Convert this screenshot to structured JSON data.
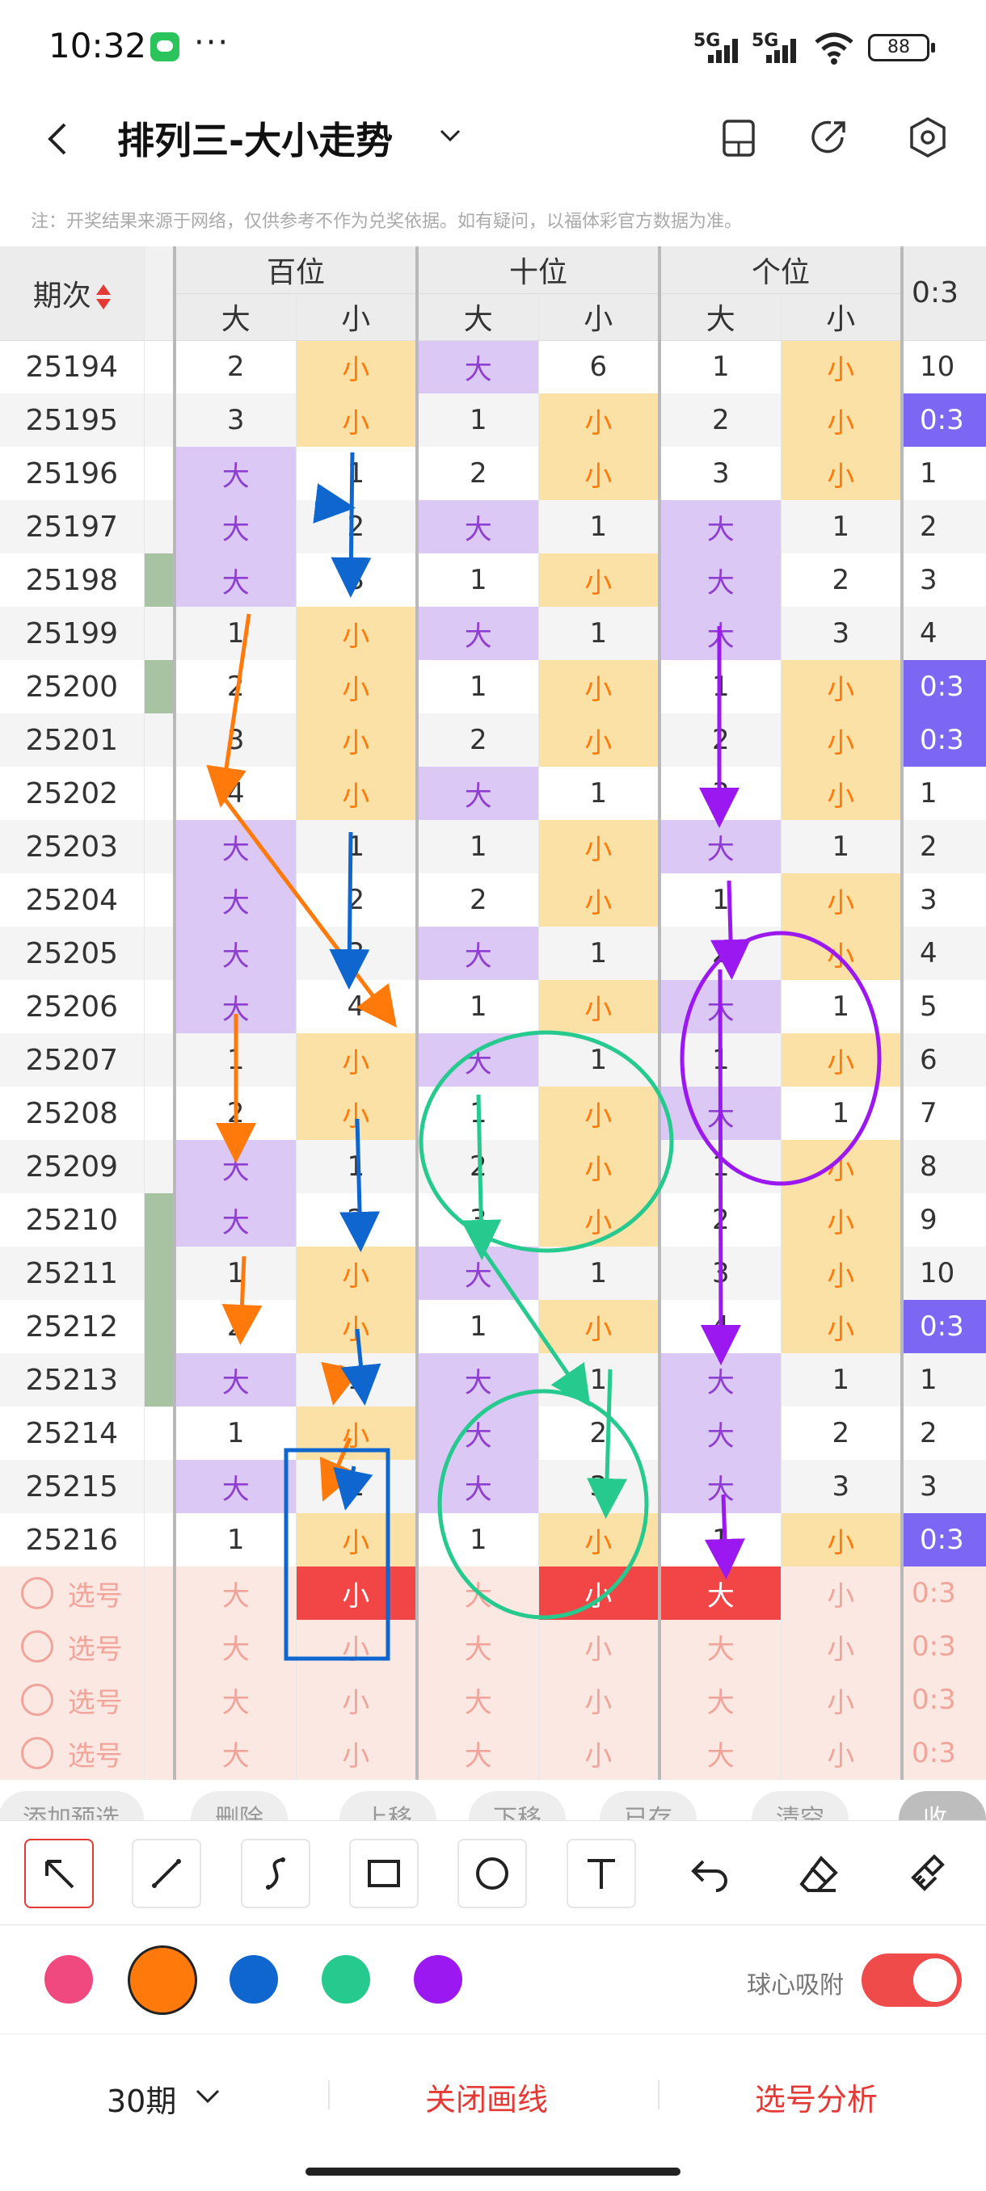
{
  "status_bar": {
    "time": "10:32",
    "more": "···",
    "signal_1": "5G",
    "signal_2": "5G",
    "battery": "88"
  },
  "header": {
    "title": "排列三-大小走势"
  },
  "notice": "注：开奖结果来源于网络，仅供参考不作为兑奖依据。如有疑问，以福体彩官方数据为准。",
  "table": {
    "issue_header": "期次",
    "groups": [
      "百位",
      "十位",
      "个位"
    ],
    "sub_headers": [
      "大",
      "小",
      "大",
      "小",
      "大",
      "小"
    ],
    "last_header": "0:3",
    "rows": [
      {
        "issue": "25194",
        "gap": false,
        "cells": [
          [
            "2",
            "n"
          ],
          [
            "小",
            "s"
          ],
          [
            "大",
            "b"
          ],
          [
            "6",
            "n"
          ],
          [
            "1",
            "n"
          ],
          [
            "小",
            "s"
          ]
        ],
        "last": [
          "10",
          "n"
        ]
      },
      {
        "issue": "25195",
        "gap": false,
        "cells": [
          [
            "3",
            "n"
          ],
          [
            "小",
            "s"
          ],
          [
            "1",
            "n"
          ],
          [
            "小",
            "s"
          ],
          [
            "2",
            "n"
          ],
          [
            "小",
            "s"
          ]
        ],
        "last": [
          "0:3",
          "h"
        ]
      },
      {
        "issue": "25196",
        "gap": false,
        "cells": [
          [
            "大",
            "b"
          ],
          [
            "1",
            "n"
          ],
          [
            "2",
            "n"
          ],
          [
            "小",
            "s"
          ],
          [
            "3",
            "n"
          ],
          [
            "小",
            "s"
          ]
        ],
        "last": [
          "1",
          "n"
        ]
      },
      {
        "issue": "25197",
        "gap": false,
        "cells": [
          [
            "大",
            "b"
          ],
          [
            "2",
            "n"
          ],
          [
            "大",
            "b"
          ],
          [
            "1",
            "n"
          ],
          [
            "大",
            "b"
          ],
          [
            "1",
            "n"
          ]
        ],
        "last": [
          "2",
          "n"
        ]
      },
      {
        "issue": "25198",
        "gap": true,
        "cells": [
          [
            "大",
            "b"
          ],
          [
            "3",
            "n"
          ],
          [
            "1",
            "n"
          ],
          [
            "小",
            "s"
          ],
          [
            "大",
            "b"
          ],
          [
            "2",
            "n"
          ]
        ],
        "last": [
          "3",
          "n"
        ]
      },
      {
        "issue": "25199",
        "gap": false,
        "cells": [
          [
            "1",
            "n"
          ],
          [
            "小",
            "s"
          ],
          [
            "大",
            "b"
          ],
          [
            "1",
            "n"
          ],
          [
            "大",
            "b"
          ],
          [
            "3",
            "n"
          ]
        ],
        "last": [
          "4",
          "n"
        ]
      },
      {
        "issue": "25200",
        "gap": true,
        "cells": [
          [
            "2",
            "n"
          ],
          [
            "小",
            "s"
          ],
          [
            "1",
            "n"
          ],
          [
            "小",
            "s"
          ],
          [
            "1",
            "n"
          ],
          [
            "小",
            "s"
          ]
        ],
        "last": [
          "0:3",
          "h"
        ]
      },
      {
        "issue": "25201",
        "gap": false,
        "cells": [
          [
            "3",
            "n"
          ],
          [
            "小",
            "s"
          ],
          [
            "2",
            "n"
          ],
          [
            "小",
            "s"
          ],
          [
            "2",
            "n"
          ],
          [
            "小",
            "s"
          ]
        ],
        "last": [
          "0:3",
          "h"
        ]
      },
      {
        "issue": "25202",
        "gap": false,
        "cells": [
          [
            "4",
            "n"
          ],
          [
            "小",
            "s"
          ],
          [
            "大",
            "b"
          ],
          [
            "1",
            "n"
          ],
          [
            "3",
            "n"
          ],
          [
            "小",
            "s"
          ]
        ],
        "last": [
          "1",
          "n"
        ]
      },
      {
        "issue": "25203",
        "gap": false,
        "cells": [
          [
            "大",
            "b"
          ],
          [
            "1",
            "n"
          ],
          [
            "1",
            "n"
          ],
          [
            "小",
            "s"
          ],
          [
            "大",
            "b"
          ],
          [
            "1",
            "n"
          ]
        ],
        "last": [
          "2",
          "n"
        ]
      },
      {
        "issue": "25204",
        "gap": false,
        "cells": [
          [
            "大",
            "b"
          ],
          [
            "2",
            "n"
          ],
          [
            "2",
            "n"
          ],
          [
            "小",
            "s"
          ],
          [
            "1",
            "n"
          ],
          [
            "小",
            "s"
          ]
        ],
        "last": [
          "3",
          "n"
        ]
      },
      {
        "issue": "25205",
        "gap": false,
        "cells": [
          [
            "大",
            "b"
          ],
          [
            "3",
            "n"
          ],
          [
            "大",
            "b"
          ],
          [
            "1",
            "n"
          ],
          [
            "2",
            "n"
          ],
          [
            "小",
            "s"
          ]
        ],
        "last": [
          "4",
          "n"
        ]
      },
      {
        "issue": "25206",
        "gap": false,
        "cells": [
          [
            "大",
            "b"
          ],
          [
            "4",
            "n"
          ],
          [
            "1",
            "n"
          ],
          [
            "小",
            "s"
          ],
          [
            "大",
            "b"
          ],
          [
            "1",
            "n"
          ]
        ],
        "last": [
          "5",
          "n"
        ]
      },
      {
        "issue": "25207",
        "gap": false,
        "cells": [
          [
            "1",
            "n"
          ],
          [
            "小",
            "s"
          ],
          [
            "大",
            "b"
          ],
          [
            "1",
            "n"
          ],
          [
            "1",
            "n"
          ],
          [
            "小",
            "s"
          ]
        ],
        "last": [
          "6",
          "n"
        ]
      },
      {
        "issue": "25208",
        "gap": false,
        "cells": [
          [
            "2",
            "n"
          ],
          [
            "小",
            "s"
          ],
          [
            "1",
            "n"
          ],
          [
            "小",
            "s"
          ],
          [
            "大",
            "b"
          ],
          [
            "1",
            "n"
          ]
        ],
        "last": [
          "7",
          "n"
        ]
      },
      {
        "issue": "25209",
        "gap": false,
        "cells": [
          [
            "大",
            "b"
          ],
          [
            "1",
            "n"
          ],
          [
            "2",
            "n"
          ],
          [
            "小",
            "s"
          ],
          [
            "1",
            "n"
          ],
          [
            "小",
            "s"
          ]
        ],
        "last": [
          "8",
          "n"
        ]
      },
      {
        "issue": "25210",
        "gap": true,
        "cells": [
          [
            "大",
            "b"
          ],
          [
            "2",
            "n"
          ],
          [
            "3",
            "n"
          ],
          [
            "小",
            "s"
          ],
          [
            "2",
            "n"
          ],
          [
            "小",
            "s"
          ]
        ],
        "last": [
          "9",
          "n"
        ]
      },
      {
        "issue": "25211",
        "gap": true,
        "cells": [
          [
            "1",
            "n"
          ],
          [
            "小",
            "s"
          ],
          [
            "大",
            "b"
          ],
          [
            "1",
            "n"
          ],
          [
            "3",
            "n"
          ],
          [
            "小",
            "s"
          ]
        ],
        "last": [
          "10",
          "n"
        ]
      },
      {
        "issue": "25212",
        "gap": true,
        "cells": [
          [
            "2",
            "n"
          ],
          [
            "小",
            "s"
          ],
          [
            "1",
            "n"
          ],
          [
            "小",
            "s"
          ],
          [
            "4",
            "n"
          ],
          [
            "小",
            "s"
          ]
        ],
        "last": [
          "0:3",
          "h"
        ]
      },
      {
        "issue": "25213",
        "gap": true,
        "cells": [
          [
            "大",
            "b"
          ],
          [
            "1",
            "n"
          ],
          [
            "大",
            "b"
          ],
          [
            "1",
            "n"
          ],
          [
            "大",
            "b"
          ],
          [
            "1",
            "n"
          ]
        ],
        "last": [
          "1",
          "n"
        ]
      },
      {
        "issue": "25214",
        "gap": false,
        "cells": [
          [
            "1",
            "n"
          ],
          [
            "小",
            "s"
          ],
          [
            "大",
            "b"
          ],
          [
            "2",
            "n"
          ],
          [
            "大",
            "b"
          ],
          [
            "2",
            "n"
          ]
        ],
        "last": [
          "2",
          "n"
        ]
      },
      {
        "issue": "25215",
        "gap": false,
        "cells": [
          [
            "大",
            "b"
          ],
          [
            "1",
            "n"
          ],
          [
            "大",
            "b"
          ],
          [
            "3",
            "n"
          ],
          [
            "大",
            "b"
          ],
          [
            "3",
            "n"
          ]
        ],
        "last": [
          "3",
          "n"
        ]
      },
      {
        "issue": "25216",
        "gap": false,
        "cells": [
          [
            "1",
            "n"
          ],
          [
            "小",
            "s"
          ],
          [
            "1",
            "n"
          ],
          [
            "小",
            "s"
          ],
          [
            "1",
            "n"
          ],
          [
            "小",
            "s"
          ]
        ],
        "last": [
          "0:3",
          "h"
        ]
      }
    ],
    "select_rows": [
      {
        "label": "选号",
        "cells": [
          [
            "大",
            ""
          ],
          [
            "小",
            "r"
          ],
          [
            "大",
            ""
          ],
          [
            "小",
            "r"
          ],
          [
            "大",
            "r"
          ],
          [
            "小",
            ""
          ]
        ],
        "last": "0:3"
      },
      {
        "label": "选号",
        "cells": [
          [
            "大",
            ""
          ],
          [
            "小",
            ""
          ],
          [
            "大",
            ""
          ],
          [
            "小",
            ""
          ],
          [
            "大",
            ""
          ],
          [
            "小",
            ""
          ]
        ],
        "last": "0:3"
      },
      {
        "label": "选号",
        "cells": [
          [
            "大",
            ""
          ],
          [
            "小",
            ""
          ],
          [
            "大",
            ""
          ],
          [
            "小",
            ""
          ],
          [
            "大",
            ""
          ],
          [
            "小",
            ""
          ]
        ],
        "last": "0:3"
      },
      {
        "label": "选号",
        "cells": [
          [
            "大",
            ""
          ],
          [
            "小",
            ""
          ],
          [
            "大",
            ""
          ],
          [
            "小",
            ""
          ],
          [
            "大",
            ""
          ],
          [
            "小",
            ""
          ]
        ],
        "last": "0:3"
      }
    ]
  },
  "chips": [
    "添加预选",
    "删除",
    "上移",
    "下移",
    "已存",
    "清空",
    "收起"
  ],
  "palette": {
    "pink": "#f0497f",
    "orange": "#ff7a0a",
    "blue": "#0f66cf",
    "green": "#26c98e",
    "purple": "#9b19f0"
  },
  "snap": {
    "label": "球心吸附",
    "on": true
  },
  "bottom": {
    "period": "30期",
    "close_lines": "关闭画线",
    "analysis": "选号分析"
  }
}
